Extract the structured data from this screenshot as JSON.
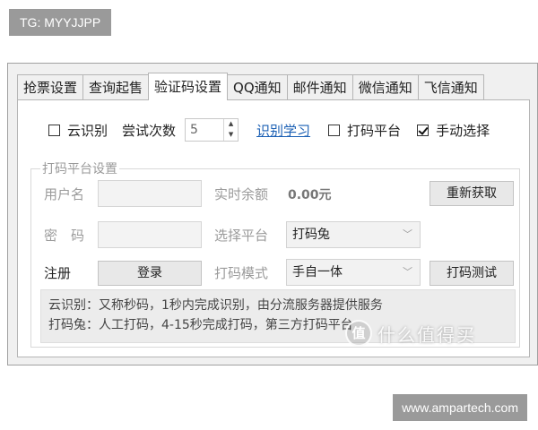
{
  "top_tag": "TG: MYYJJPP",
  "bottom_tag": "www.ampartech.com",
  "tabs": [
    {
      "label": "抢票设置"
    },
    {
      "label": "查询起售"
    },
    {
      "label": "验证码设置"
    },
    {
      "label": "QQ通知"
    },
    {
      "label": "邮件通知"
    },
    {
      "label": "微信通知"
    },
    {
      "label": "飞信通知"
    }
  ],
  "active_tab_index": 2,
  "row1": {
    "cloud_recognition": {
      "label": "云识别",
      "checked": false
    },
    "attempts_label": "尝试次数",
    "attempts_value": "5",
    "recognition_learning_link": "识别学习",
    "captcha_platform": {
      "label": "打码平台",
      "checked": false
    },
    "manual_select": {
      "label": "手动选择",
      "checked": true
    }
  },
  "platform_group": {
    "title": "打码平台设置",
    "username_label": "用户名",
    "password_label": "密　码",
    "register_label": "注册",
    "login_button": "登录",
    "balance_label": "实时余额",
    "balance_value": "0.00元",
    "refresh_button": "重新获取",
    "platform_label": "选择平台",
    "platform_value": "打码兔",
    "mode_label": "打码模式",
    "mode_value": "手自一体",
    "test_button": "打码测试"
  },
  "info": {
    "line1": "云识别：又称秒码，1秒内完成识别，由分流服务器提供服务",
    "line2": "打码兔：人工打码，4-15秒完成打码，第三方打码平台"
  },
  "watermark": {
    "logo": "值",
    "text": "什么值得买"
  }
}
